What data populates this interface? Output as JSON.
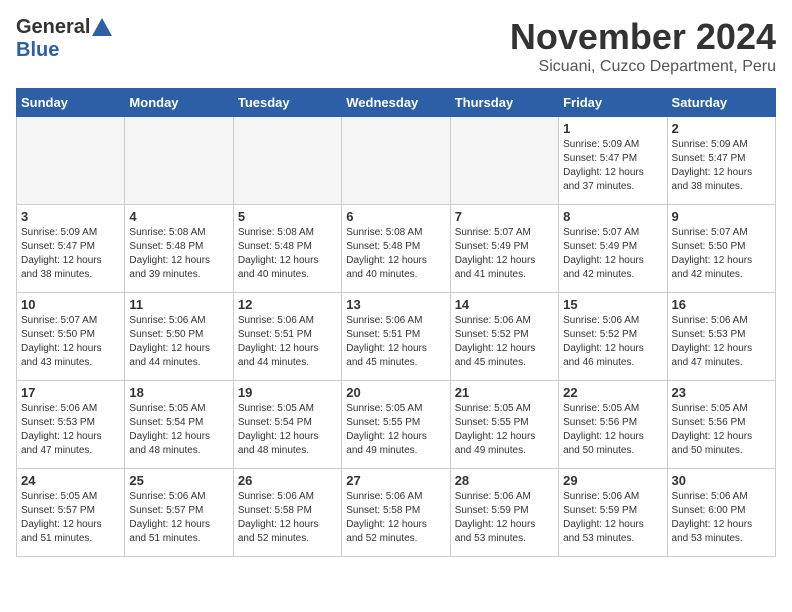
{
  "logo": {
    "general": "General",
    "blue": "Blue"
  },
  "title": "November 2024",
  "subtitle": "Sicuani, Cuzco Department, Peru",
  "weekdays": [
    "Sunday",
    "Monday",
    "Tuesday",
    "Wednesday",
    "Thursday",
    "Friday",
    "Saturday"
  ],
  "weeks": [
    [
      {
        "day": "",
        "info": ""
      },
      {
        "day": "",
        "info": ""
      },
      {
        "day": "",
        "info": ""
      },
      {
        "day": "",
        "info": ""
      },
      {
        "day": "",
        "info": ""
      },
      {
        "day": "1",
        "info": "Sunrise: 5:09 AM\nSunset: 5:47 PM\nDaylight: 12 hours\nand 37 minutes."
      },
      {
        "day": "2",
        "info": "Sunrise: 5:09 AM\nSunset: 5:47 PM\nDaylight: 12 hours\nand 38 minutes."
      }
    ],
    [
      {
        "day": "3",
        "info": "Sunrise: 5:09 AM\nSunset: 5:47 PM\nDaylight: 12 hours\nand 38 minutes."
      },
      {
        "day": "4",
        "info": "Sunrise: 5:08 AM\nSunset: 5:48 PM\nDaylight: 12 hours\nand 39 minutes."
      },
      {
        "day": "5",
        "info": "Sunrise: 5:08 AM\nSunset: 5:48 PM\nDaylight: 12 hours\nand 40 minutes."
      },
      {
        "day": "6",
        "info": "Sunrise: 5:08 AM\nSunset: 5:48 PM\nDaylight: 12 hours\nand 40 minutes."
      },
      {
        "day": "7",
        "info": "Sunrise: 5:07 AM\nSunset: 5:49 PM\nDaylight: 12 hours\nand 41 minutes."
      },
      {
        "day": "8",
        "info": "Sunrise: 5:07 AM\nSunset: 5:49 PM\nDaylight: 12 hours\nand 42 minutes."
      },
      {
        "day": "9",
        "info": "Sunrise: 5:07 AM\nSunset: 5:50 PM\nDaylight: 12 hours\nand 42 minutes."
      }
    ],
    [
      {
        "day": "10",
        "info": "Sunrise: 5:07 AM\nSunset: 5:50 PM\nDaylight: 12 hours\nand 43 minutes."
      },
      {
        "day": "11",
        "info": "Sunrise: 5:06 AM\nSunset: 5:50 PM\nDaylight: 12 hours\nand 44 minutes."
      },
      {
        "day": "12",
        "info": "Sunrise: 5:06 AM\nSunset: 5:51 PM\nDaylight: 12 hours\nand 44 minutes."
      },
      {
        "day": "13",
        "info": "Sunrise: 5:06 AM\nSunset: 5:51 PM\nDaylight: 12 hours\nand 45 minutes."
      },
      {
        "day": "14",
        "info": "Sunrise: 5:06 AM\nSunset: 5:52 PM\nDaylight: 12 hours\nand 45 minutes."
      },
      {
        "day": "15",
        "info": "Sunrise: 5:06 AM\nSunset: 5:52 PM\nDaylight: 12 hours\nand 46 minutes."
      },
      {
        "day": "16",
        "info": "Sunrise: 5:06 AM\nSunset: 5:53 PM\nDaylight: 12 hours\nand 47 minutes."
      }
    ],
    [
      {
        "day": "17",
        "info": "Sunrise: 5:06 AM\nSunset: 5:53 PM\nDaylight: 12 hours\nand 47 minutes."
      },
      {
        "day": "18",
        "info": "Sunrise: 5:05 AM\nSunset: 5:54 PM\nDaylight: 12 hours\nand 48 minutes."
      },
      {
        "day": "19",
        "info": "Sunrise: 5:05 AM\nSunset: 5:54 PM\nDaylight: 12 hours\nand 48 minutes."
      },
      {
        "day": "20",
        "info": "Sunrise: 5:05 AM\nSunset: 5:55 PM\nDaylight: 12 hours\nand 49 minutes."
      },
      {
        "day": "21",
        "info": "Sunrise: 5:05 AM\nSunset: 5:55 PM\nDaylight: 12 hours\nand 49 minutes."
      },
      {
        "day": "22",
        "info": "Sunrise: 5:05 AM\nSunset: 5:56 PM\nDaylight: 12 hours\nand 50 minutes."
      },
      {
        "day": "23",
        "info": "Sunrise: 5:05 AM\nSunset: 5:56 PM\nDaylight: 12 hours\nand 50 minutes."
      }
    ],
    [
      {
        "day": "24",
        "info": "Sunrise: 5:05 AM\nSunset: 5:57 PM\nDaylight: 12 hours\nand 51 minutes."
      },
      {
        "day": "25",
        "info": "Sunrise: 5:06 AM\nSunset: 5:57 PM\nDaylight: 12 hours\nand 51 minutes."
      },
      {
        "day": "26",
        "info": "Sunrise: 5:06 AM\nSunset: 5:58 PM\nDaylight: 12 hours\nand 52 minutes."
      },
      {
        "day": "27",
        "info": "Sunrise: 5:06 AM\nSunset: 5:58 PM\nDaylight: 12 hours\nand 52 minutes."
      },
      {
        "day": "28",
        "info": "Sunrise: 5:06 AM\nSunset: 5:59 PM\nDaylight: 12 hours\nand 53 minutes."
      },
      {
        "day": "29",
        "info": "Sunrise: 5:06 AM\nSunset: 5:59 PM\nDaylight: 12 hours\nand 53 minutes."
      },
      {
        "day": "30",
        "info": "Sunrise: 5:06 AM\nSunset: 6:00 PM\nDaylight: 12 hours\nand 53 minutes."
      }
    ]
  ]
}
